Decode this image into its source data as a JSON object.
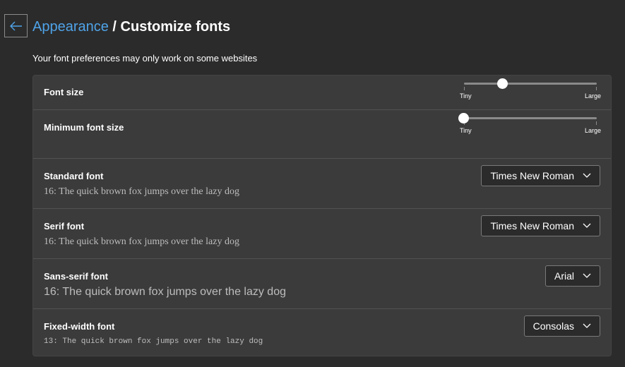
{
  "header": {
    "breadcrumb_parent": "Appearance",
    "separator": " / ",
    "title": "Customize fonts"
  },
  "subtitle": "Your font preferences may only work on some websites",
  "settings": {
    "font_size": {
      "label": "Font size",
      "min_label": "Tiny",
      "max_label": "Large",
      "value_fraction": 0.29
    },
    "minimum_font_size": {
      "label": "Minimum font size",
      "min_label": "Tiny",
      "max_label": "Large",
      "value_fraction": 0.0
    },
    "standard_font": {
      "label": "Standard font",
      "sample": "16: The quick brown fox jumps over the lazy dog",
      "selected": "Times New Roman"
    },
    "serif_font": {
      "label": "Serif font",
      "sample": "16: The quick brown fox jumps over the lazy dog",
      "selected": "Times New Roman"
    },
    "sans_serif_font": {
      "label": "Sans-serif font",
      "sample": "16: The quick brown fox jumps over the lazy dog",
      "selected": "Arial"
    },
    "fixed_width_font": {
      "label": "Fixed-width font",
      "sample": "13: The quick brown fox jumps over the lazy dog",
      "selected": "Consolas"
    }
  },
  "colors": {
    "background": "#2b2b2b",
    "card": "#3b3b3b",
    "accent_link": "#4fa3e8"
  },
  "icons": {
    "back": "arrow-left-icon",
    "dropdown": "chevron-down-icon"
  }
}
